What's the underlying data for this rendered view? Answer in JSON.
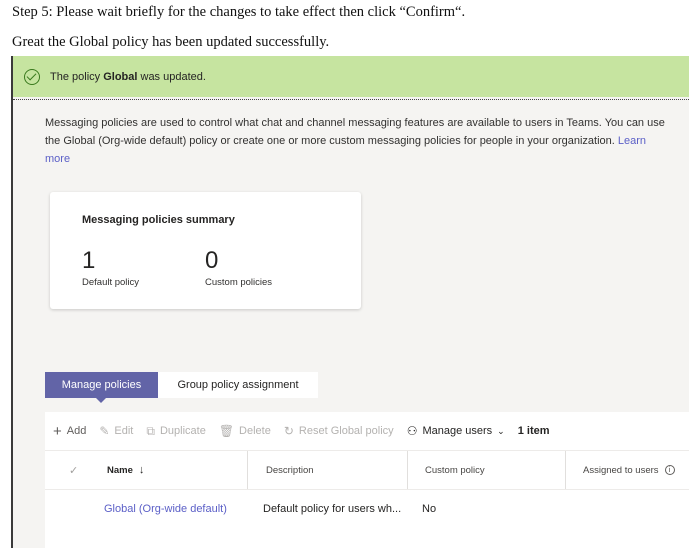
{
  "doc": {
    "step": "Step 5: Please wait briefly for the changes to take effect then click “Confirm“.",
    "great": "Great the Global policy has been updated successfully."
  },
  "banner": {
    "prefix": "The policy ",
    "policy": "Global",
    "suffix": " was updated."
  },
  "description": {
    "text": "Messaging policies are used to control what chat and channel messaging features are available to users in Teams. You can use the Global (Org-wide default) policy or create one or more custom messaging policies for people in your organization. ",
    "link": "Learn more"
  },
  "summary": {
    "title": "Messaging policies summary",
    "default_count": "1",
    "default_label": "Default policy",
    "custom_count": "0",
    "custom_label": "Custom policies"
  },
  "tabs": {
    "manage": "Manage policies",
    "group": "Group policy assignment"
  },
  "toolbar": {
    "add": "Add",
    "edit": "Edit",
    "duplicate": "Duplicate",
    "delete": "Delete",
    "reset": "Reset Global policy",
    "manage_users": "Manage users",
    "count": "1 item"
  },
  "table": {
    "headers": {
      "name": "Name",
      "description": "Description",
      "custom": "Custom policy",
      "assigned": "Assigned to users"
    },
    "rows": [
      {
        "name": "Global (Org-wide default)",
        "description": "Default policy for users wh...",
        "custom": "No"
      }
    ]
  },
  "colors": {
    "accent": "#6264a7",
    "success_bg": "#c6e4a0",
    "link": "#5b5fc7"
  }
}
